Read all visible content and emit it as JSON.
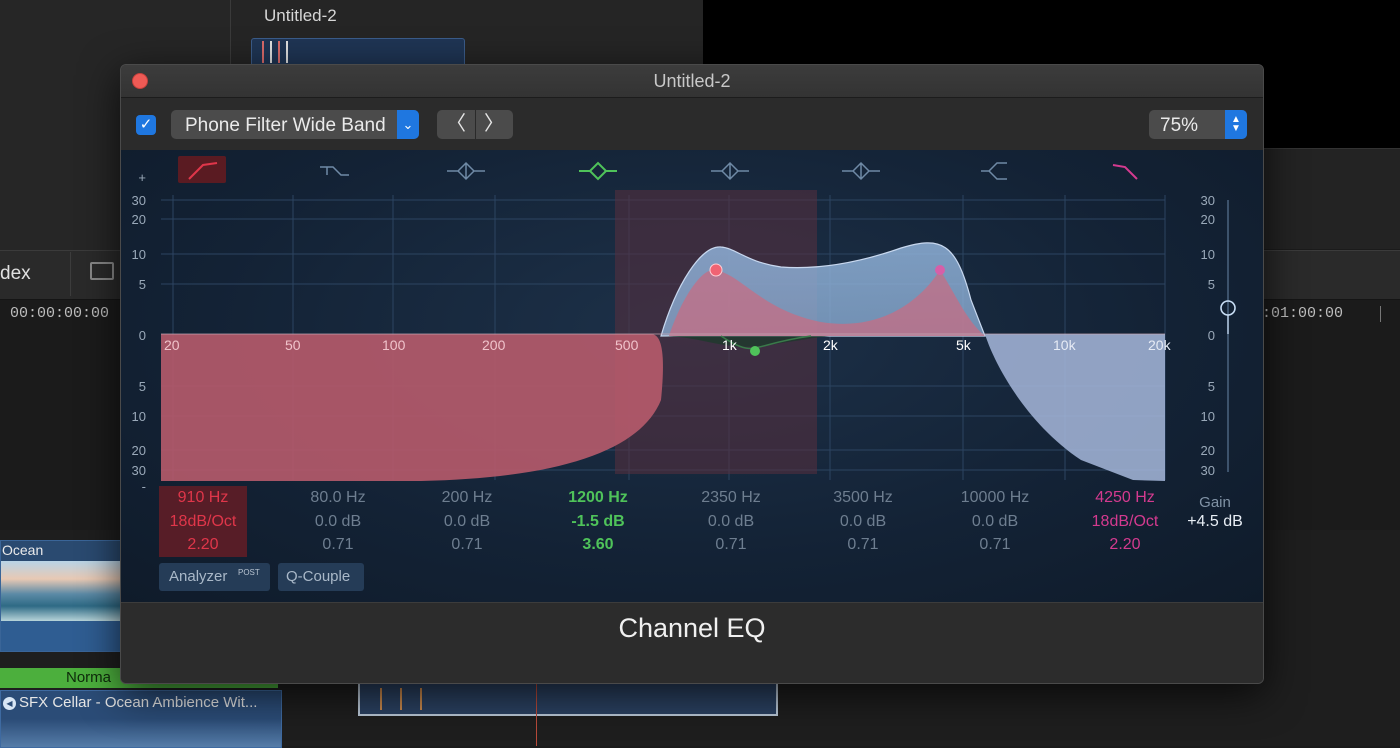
{
  "background": {
    "project_title": "Untitled-2",
    "timeline_label": "dex",
    "timecode_left": "00:00:00:00",
    "timecode_right": ":01:00:00",
    "clip_ocean": "Ocean",
    "clip_green": "Norma",
    "clip_sfx": "SFX Cellar - Ocean Ambience Wit..."
  },
  "window": {
    "title": "Untitled-2",
    "footer_title": "Channel EQ"
  },
  "toolbar": {
    "bypass_checked": "✓",
    "preset": "Phone Filter Wide Band",
    "preset_arrow": "⌄",
    "prev": "〈",
    "next": "〉",
    "zoom": "75%",
    "zoom_up": "▲",
    "zoom_down": "▼"
  },
  "eq": {
    "db_scale_top": [
      "+",
      "30",
      "20",
      "10",
      "5",
      "0",
      "5",
      "10",
      "20",
      "30",
      "-"
    ],
    "freq_labels": [
      "20",
      "50",
      "100",
      "200",
      "500",
      "1k",
      "2k",
      "5k",
      "10k",
      "20k"
    ],
    "bands": [
      {
        "freq": "910 Hz",
        "gain": "18dB/Oct",
        "q": "2.20",
        "color": "#e0364a",
        "icon": "high-pass-icon"
      },
      {
        "freq": "80.0 Hz",
        "gain": "0.0 dB",
        "q": "0.71",
        "color": "#6e7e90",
        "icon": "low-shelf-icon"
      },
      {
        "freq": "200 Hz",
        "gain": "0.0 dB",
        "q": "0.71",
        "color": "#6e7e90",
        "icon": "bell-icon"
      },
      {
        "freq": "1200 Hz",
        "gain": "-1.5 dB",
        "q": "3.60",
        "color": "#4fc35a",
        "icon": "bell-icon"
      },
      {
        "freq": "2350 Hz",
        "gain": "0.0 dB",
        "q": "0.71",
        "color": "#6e7e90",
        "icon": "bell-icon"
      },
      {
        "freq": "3500 Hz",
        "gain": "0.0 dB",
        "q": "0.71",
        "color": "#6e7e90",
        "icon": "bell-icon"
      },
      {
        "freq": "10000 Hz",
        "gain": "0.0 dB",
        "q": "0.71",
        "color": "#6e7e90",
        "icon": "high-shelf-icon"
      },
      {
        "freq": "4250 Hz",
        "gain": "18dB/Oct",
        "q": "2.20",
        "color": "#d43a8f",
        "icon": "low-pass-icon"
      }
    ],
    "gain_label": "Gain",
    "gain_value": "+4.5 dB",
    "gain_level_db": 4.5,
    "analyzer_label": "Analyzer",
    "analyzer_badge": "POST",
    "qcouple_label": "Q-Couple"
  }
}
